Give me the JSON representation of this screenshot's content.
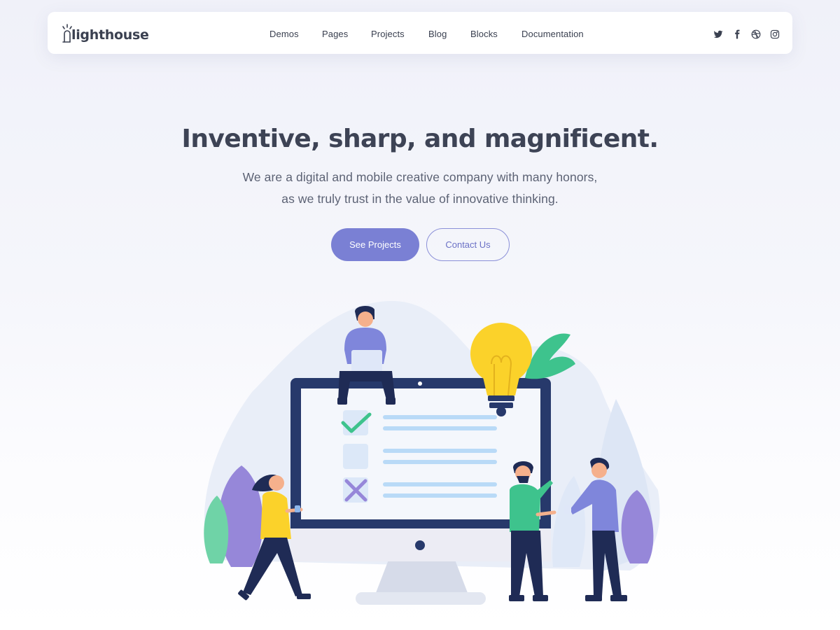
{
  "brand": {
    "name": "Lighthouse",
    "text": "lighthouse"
  },
  "nav": {
    "items": [
      {
        "label": "Demos"
      },
      {
        "label": "Pages"
      },
      {
        "label": "Projects"
      },
      {
        "label": "Blog"
      },
      {
        "label": "Blocks"
      },
      {
        "label": "Documentation"
      }
    ]
  },
  "social": [
    "twitter-icon",
    "facebook-icon",
    "dribbble-icon",
    "instagram-icon"
  ],
  "hero": {
    "title": "Inventive, sharp, and magnificent.",
    "subtitle_line1": "We are a digital and mobile creative company with many honors,",
    "subtitle_line2": "as we truly trust in the value of innovative thinking.",
    "primary_button": "See Projects",
    "secondary_button": "Contact Us"
  },
  "colors": {
    "accent": "#7a80d4",
    "heading": "#3d4355",
    "monitor": "#27396b",
    "bulb": "#fbd22a",
    "green": "#3ec38d",
    "purple": "#9687d9"
  }
}
